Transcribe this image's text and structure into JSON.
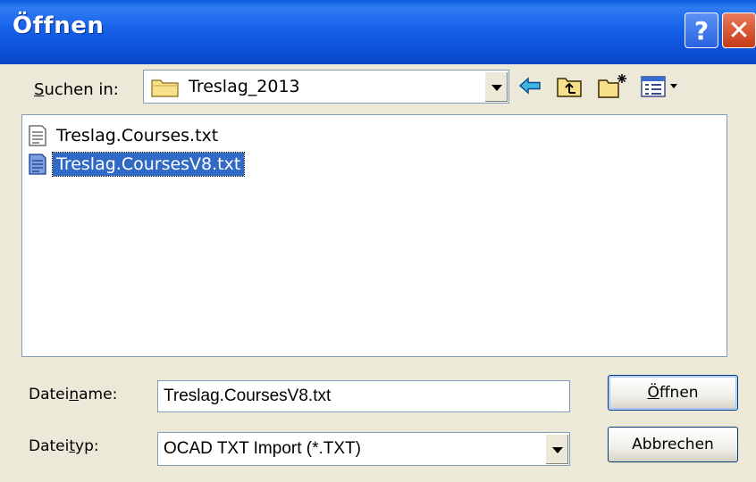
{
  "window": {
    "title": "Öffnen",
    "help_label": "?",
    "close_label": "✕"
  },
  "lookin": {
    "label_underline": "S",
    "label_rest": "uchen in:",
    "value": "Treslag_2013"
  },
  "toolbar": {
    "back_icon": "back-arrow-icon",
    "up_icon": "up-folder-icon",
    "new_folder_icon": "new-folder-icon",
    "view_icon": "view-menu-icon"
  },
  "files": [
    {
      "name": "Treslag.Courses.txt",
      "selected": false
    },
    {
      "name": "Treslag.CoursesV8.txt",
      "selected": true
    }
  ],
  "filename": {
    "label_pre": "Datei",
    "label_underline": "n",
    "label_post": "ame:",
    "value": "Treslag.CoursesV8.txt"
  },
  "filetype": {
    "label_pre": "Datei",
    "label_underline": "t",
    "label_post": "yp:",
    "value": "OCAD TXT Import (*.TXT)"
  },
  "buttons": {
    "open_underline": "Ö",
    "open_rest": "ffnen",
    "cancel": "Abbrechen"
  },
  "colors": {
    "titlebar": "#0B4FD6",
    "selection": "#316AC5",
    "dialog_bg": "#ECE9D8",
    "close": "#C63A16"
  }
}
